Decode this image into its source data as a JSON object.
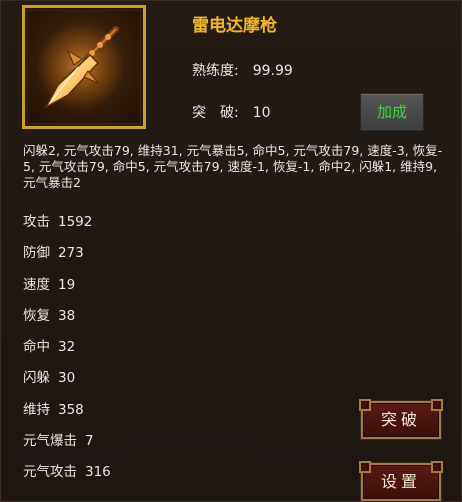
{
  "weapon": {
    "name": "雷电达摩枪",
    "mastery_label": "熟练度:",
    "mastery_value": "99.99",
    "breakthrough_label": "突　破:",
    "breakthrough_value": "10",
    "bonus_button": "加成"
  },
  "affix_text": "闪躲2, 元气攻击79, 维持31, 元气暴击5, 命中5, 元气攻击79, 速度-3, 恢复-5, 元气攻击79, 命中5, 元气攻击79, 速度-1, 恢复-1, 命中2, 闪躲1, 维持9, 元气暴击2",
  "attributes": [
    {
      "label": "攻击",
      "value": "1592"
    },
    {
      "label": "防御",
      "value": "273"
    },
    {
      "label": "速度",
      "value": "19"
    },
    {
      "label": "恢复",
      "value": "38"
    },
    {
      "label": "命中",
      "value": "32"
    },
    {
      "label": "闪躲",
      "value": "30"
    },
    {
      "label": "维持",
      "value": "358"
    },
    {
      "label": "元气爆击",
      "value": "7"
    },
    {
      "label": "元气攻击",
      "value": "316"
    }
  ],
  "actions": {
    "breakthrough_button": "突破",
    "settings_button": "设置"
  },
  "icons": {
    "weapon_icon": "spear-icon"
  },
  "colors": {
    "name": "#f0b72b",
    "bonus_text": "#3fd33f",
    "frame_gold": "#c9a227",
    "button_red": "#5a1a14"
  }
}
